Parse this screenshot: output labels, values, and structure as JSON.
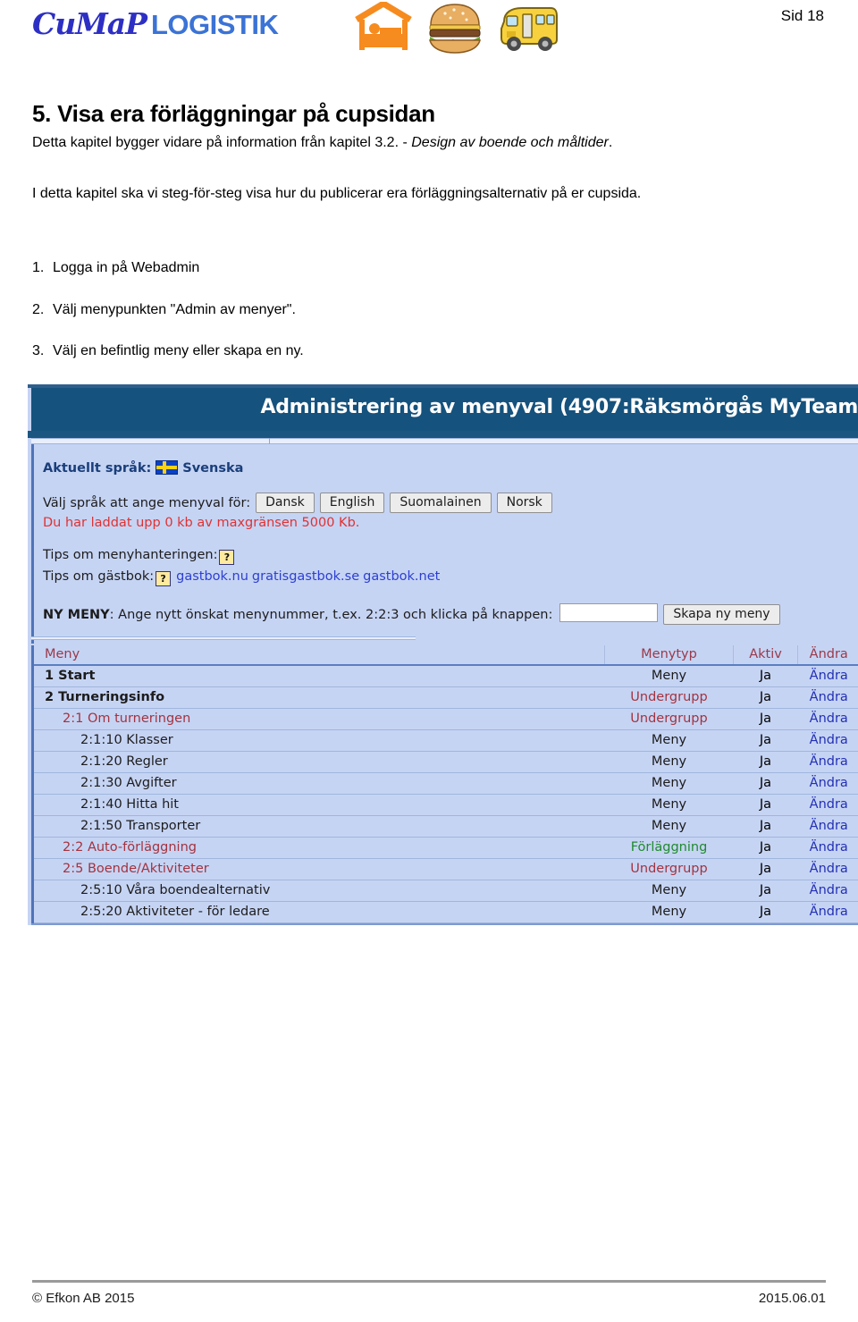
{
  "header": {
    "logo_primary": "CuMaP",
    "logo_secondary": "LOGISTIK",
    "page_label": "Sid 18",
    "icons": [
      "lodging-bed-icon",
      "hamburger-meal-icon",
      "bus-transport-icon"
    ]
  },
  "content": {
    "section_number": "5.",
    "section_title": "Visa era förläggningar på cupsidan",
    "lead_before": "Detta kapitel bygger vidare på information från kapitel 3.2. - ",
    "lead_italic": "Design av boende och måltider",
    "lead_after": ".",
    "paragraph": "I detta kapitel ska vi steg-för-steg visa hur du publicerar era förläggningsalternativ på er cupsida.",
    "steps": [
      {
        "n": "1.",
        "text": "Logga in på Webadmin"
      },
      {
        "n": "2.",
        "text": "Välj menypunkten \"Admin av menyer\"."
      },
      {
        "n": "3.",
        "text": "Välj en befintlig meny eller skapa en ny."
      }
    ]
  },
  "screenshot": {
    "title": "Administrering av menyval (4907:Räksmörgås MyTeam",
    "current_language_label": "Aktuellt språk:",
    "current_language_value": "Svenska",
    "language_flag": "swedish-flag-icon",
    "language_select_label": "Välj språk att ange menyval för:",
    "language_buttons": [
      "Dansk",
      "English",
      "Suomalainen",
      "Norsk"
    ],
    "quota_text": "Du har laddat upp 0 kb av maxgränsen 5000 Kb.",
    "tips_menu_label": "Tips om menyhanteringen:",
    "tips_guestbook_label": "Tips om gästbok:",
    "help_glyph": "?",
    "guestbook_links": [
      "gastbok.nu",
      "gratisgastbok.se",
      "gastbok.net"
    ],
    "new_menu_strong": "NY MENY",
    "new_menu_text": ": Ange nytt önskat menynummer, t.ex. 2:2:3 och klicka på knappen:",
    "new_menu_input_value": "",
    "new_menu_button": "Skapa ny meny",
    "table": {
      "columns": [
        "Meny",
        "Menytyp",
        "Aktiv",
        "Ändra"
      ],
      "rows": [
        {
          "level": 1,
          "meny": "1 Start",
          "menytyp": "Meny",
          "typ_style": "meny",
          "aktiv": "Ja",
          "andra": "Ändra"
        },
        {
          "level": 1,
          "meny": "2 Turneringsinfo",
          "menytyp": "Undergrupp",
          "typ_style": "undergrupp",
          "aktiv": "Ja",
          "andra": "Ändra"
        },
        {
          "level": 2,
          "meny": "2:1 Om turneringen",
          "menytyp": "Undergrupp",
          "typ_style": "undergrupp",
          "aktiv": "Ja",
          "andra": "Ändra"
        },
        {
          "level": 3,
          "meny": "2:1:10 Klasser",
          "menytyp": "Meny",
          "typ_style": "meny",
          "aktiv": "Ja",
          "andra": "Ändra"
        },
        {
          "level": 3,
          "meny": "2:1:20 Regler",
          "menytyp": "Meny",
          "typ_style": "meny",
          "aktiv": "Ja",
          "andra": "Ändra"
        },
        {
          "level": 3,
          "meny": "2:1:30 Avgifter",
          "menytyp": "Meny",
          "typ_style": "meny",
          "aktiv": "Ja",
          "andra": "Ändra"
        },
        {
          "level": 3,
          "meny": "2:1:40 Hitta hit",
          "menytyp": "Meny",
          "typ_style": "meny",
          "aktiv": "Ja",
          "andra": "Ändra"
        },
        {
          "level": 3,
          "meny": "2:1:50 Transporter",
          "menytyp": "Meny",
          "typ_style": "meny",
          "aktiv": "Ja",
          "andra": "Ändra"
        },
        {
          "level": 2,
          "meny": "2:2 Auto-förläggning",
          "menytyp": "Förläggning",
          "typ_style": "forlaggning",
          "aktiv": "Ja",
          "andra": "Ändra"
        },
        {
          "level": 2,
          "meny": "2:5 Boende/Aktiviteter",
          "menytyp": "Undergrupp",
          "typ_style": "undergrupp",
          "aktiv": "Ja",
          "andra": "Ändra"
        },
        {
          "level": 3,
          "meny": "2:5:10 Våra boendealternativ",
          "menytyp": "Meny",
          "typ_style": "meny",
          "aktiv": "Ja",
          "andra": "Ändra"
        },
        {
          "level": 3,
          "meny": "2:5:20 Aktiviteter - för ledare",
          "menytyp": "Meny",
          "typ_style": "meny",
          "aktiv": "Ja",
          "andra": "Ändra"
        }
      ]
    }
  },
  "footer": {
    "copyright": "© Efkon AB 2015",
    "date": "2015.06.01"
  },
  "colors": {
    "titlebar": "#15527d",
    "panel": "#c6d4f4",
    "accent_red": "#a3333f",
    "accent_green": "#1f8a2e",
    "link_blue": "#2330b5",
    "warning_red": "#e03232"
  }
}
